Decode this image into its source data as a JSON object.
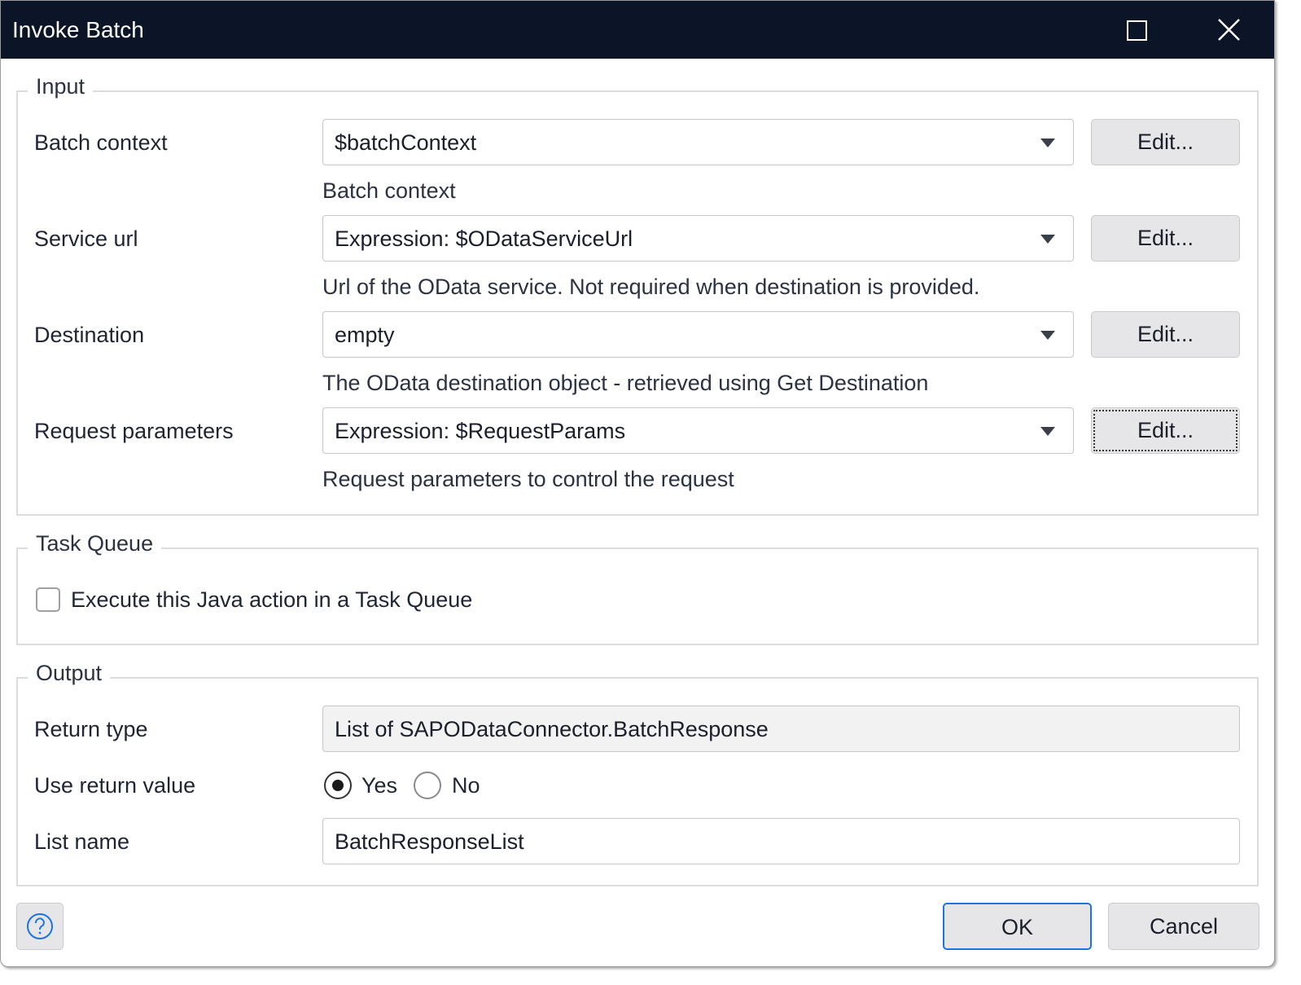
{
  "window": {
    "title": "Invoke Batch"
  },
  "input": {
    "legend": "Input",
    "rows": [
      {
        "label": "Batch context",
        "value": "$batchContext",
        "edit": "Edit...",
        "hint": "Batch context"
      },
      {
        "label": "Service url",
        "value": "Expression: $ODataServiceUrl",
        "edit": "Edit...",
        "hint": "Url of the OData service. Not required when destination is provided."
      },
      {
        "label": "Destination",
        "value": "empty",
        "edit": "Edit...",
        "hint": "The OData destination object - retrieved using Get Destination"
      },
      {
        "label": "Request parameters",
        "value": "Expression: $RequestParams",
        "edit": "Edit...",
        "hint": "Request parameters to control the request"
      }
    ]
  },
  "task_queue": {
    "legend": "Task Queue",
    "checkbox_label": "Execute this Java action in a Task Queue",
    "checked": false
  },
  "output": {
    "legend": "Output",
    "return_type_label": "Return type",
    "return_type": "List of SAPODataConnector.BatchResponse",
    "use_return_label": "Use return value",
    "yes": "Yes",
    "no": "No",
    "selected": "Yes",
    "list_name_label": "List name",
    "list_name": "BatchResponseList"
  },
  "footer": {
    "ok": "OK",
    "cancel": "Cancel"
  },
  "colors": {
    "titlebar": "#0c1527",
    "accent": "#1a73e8"
  }
}
